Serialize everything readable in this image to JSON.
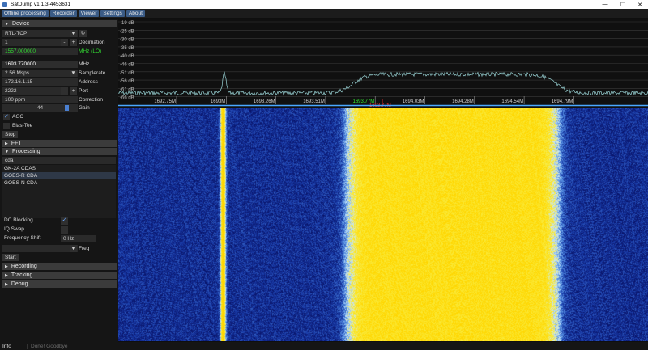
{
  "window": {
    "title": "SatDump v1.1.3-4453631",
    "minimize": "—",
    "maximize": "☐",
    "close": "✕"
  },
  "menu": [
    "Offline processing",
    "Recorder",
    "Viewer",
    "Settings",
    "About"
  ],
  "device": {
    "header": "Device",
    "source": "RTL-TCP",
    "source_arrow": "▼",
    "refresh_icon": "↻",
    "decimation_value": "1",
    "minus": "-",
    "plus": "+",
    "decimation_label": "Decimation",
    "lo_value": "1557.000000",
    "lo_label": "MHz (LO)",
    "frequency": "1693.770000",
    "frequency_unit": "MHz",
    "samplerate_value": "2.56 Msps",
    "samplerate_label": "Samplerate",
    "address_value": "172.16.1.15",
    "address_label": "Address",
    "port_value": "2222",
    "port_label": "Port",
    "correction_value": "100 ppm",
    "correction_label": "Correction",
    "gain_value": "44",
    "gain_label": "Gain",
    "gain_fraction": 0.88,
    "agc_label": "AGC",
    "agc_checked": true,
    "biastee_label": "Bias-Tee",
    "biastee_checked": false,
    "stop_label": "Stop"
  },
  "fft": {
    "header": "FFT"
  },
  "processing": {
    "header": "Processing",
    "search": "cda",
    "items": [
      {
        "label": "GK-2A CDAS"
      },
      {
        "label": "GOES-R CDA"
      },
      {
        "label": "GOES-N CDA"
      }
    ],
    "dc_blocking_label": "DC Blocking",
    "iq_swap_label": "IQ Swap",
    "freq_shift_label": "Frequency Shift",
    "freq_shift_value": "0 Hz",
    "freq_label": "Freq",
    "start_label": "Start"
  },
  "sections": [
    "Recording",
    "Tracking",
    "Debug"
  ],
  "spectrum": {
    "db_labels": [
      "-19 dB",
      "-25 dB",
      "-30 dB",
      "-35 dB",
      "-40 dB",
      "-46 dB",
      "-51 dB",
      "-56 dB",
      "-61 dB",
      "-66 dB"
    ],
    "freq_labels": [
      "1692.75M",
      "1693M",
      "1693.26M",
      "1693.51M",
      "1693.77M",
      "1694.03M",
      "1694.28M",
      "1694.54M",
      "1694.79M"
    ],
    "center_label": "1693.77M",
    "marker_label": "1693.77M",
    "colors": {
      "trace": "#9ad4d6",
      "center": "#33ee33",
      "marker": "#ff3030"
    }
  },
  "status": {
    "info": "Info",
    "message": "Done! Goodbye"
  }
}
